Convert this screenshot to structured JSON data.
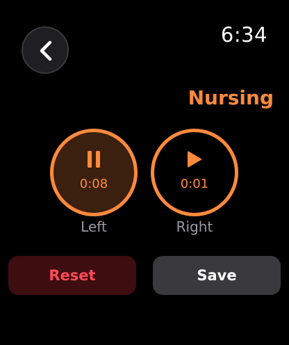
{
  "status_bar": {
    "time": "6:34"
  },
  "header": {
    "back_icon": "chevron-left-icon",
    "title": "Nursing"
  },
  "timers": {
    "left": {
      "state_icon": "pause-icon",
      "time": "0:08",
      "label": "Left"
    },
    "right": {
      "state_icon": "play-icon",
      "time": "0:01",
      "label": "Right"
    }
  },
  "actions": {
    "reset_label": "Reset",
    "save_label": "Save"
  },
  "colors": {
    "accent": "#ff8a3d",
    "destructive": "#ff4a55",
    "background": "#000000"
  }
}
